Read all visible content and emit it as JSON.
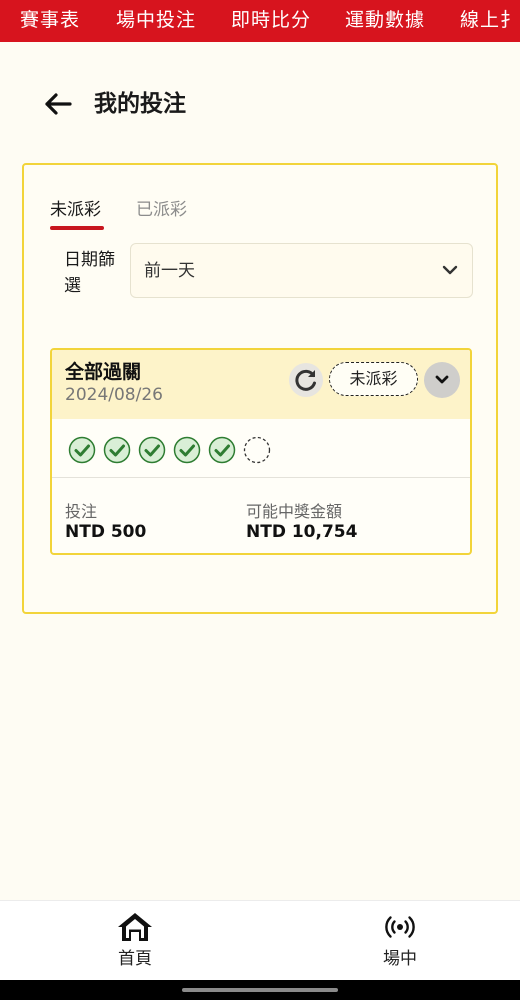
{
  "top_nav": {
    "tabs": [
      "賽事表",
      "場中投注",
      "即時比分",
      "運動數據",
      "線上扌"
    ]
  },
  "header": {
    "title": "我的投注",
    "back_icon": "back-arrow-icon"
  },
  "bets_panel": {
    "tabs": [
      {
        "label": "未派彩",
        "active": true
      },
      {
        "label": "已派彩",
        "active": false
      }
    ],
    "date_filter": {
      "label": "日期篩選",
      "value": "前一天"
    },
    "bet_card": {
      "bet_type": "全部過關",
      "date": "2024/08/26",
      "status": "未派彩",
      "legs": [
        "won",
        "won",
        "won",
        "won",
        "won",
        "pending"
      ],
      "stake_label": "投注",
      "stake_value": "NTD 500",
      "potential_win_label": "可能中獎金額",
      "potential_win_value": "NTD 10,754"
    }
  },
  "bottom_nav": {
    "items": [
      {
        "label": "首頁",
        "icon": "home-icon"
      },
      {
        "label": "場中",
        "icon": "live-broadcast-icon"
      }
    ]
  },
  "colors": {
    "brand_red": "#d7141e",
    "accent_yellow": "#f2d43a",
    "check_green": "#2e7d32"
  }
}
